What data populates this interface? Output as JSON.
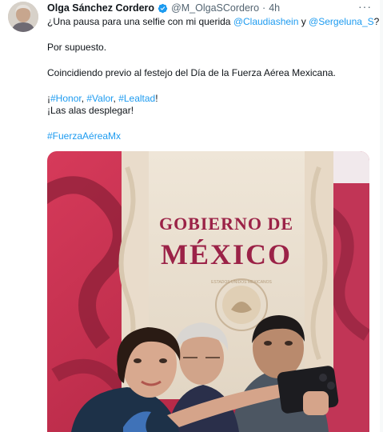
{
  "tweet": {
    "author_name": "Olga Sánchez Cordero",
    "handle": "@M_OlgaSCordero",
    "separator": "·",
    "time": "4h",
    "more_label": "···",
    "line1": {
      "prefix": "¿Una pausa para una selfie con mi querida ",
      "mention1": "@Claudiashein",
      "middle": " y ",
      "mention2": "@Sergeluna_S",
      "suffix": "?"
    },
    "line2": "Por supuesto.",
    "line3": "Coincidiendo previo al festejo del Día de la Fuerza Aérea Mexicana.",
    "line4": {
      "prefix": "¡",
      "tag1": "#Honor",
      "sep1": ", ",
      "tag2": "#Valor",
      "sep2": ", ",
      "tag3": "#Lealtad",
      "suffix": "!"
    },
    "line5": "¡Las alas desplegar!",
    "line6": "#FuerzaAéreaMx"
  },
  "photo": {
    "banner_line1": "GOBIERNO DE",
    "banner_line2": "MÉXICO",
    "seal_text": "ESTADOS UNIDOS MEXICANOS"
  },
  "colors": {
    "link": "#1d9bf0",
    "verified": "#1d9bf0",
    "banner_text": "#9b2247",
    "wall_red": "#c8324f"
  },
  "icons": {
    "verified": "verified-badge-icon",
    "more": "more-options-icon"
  }
}
